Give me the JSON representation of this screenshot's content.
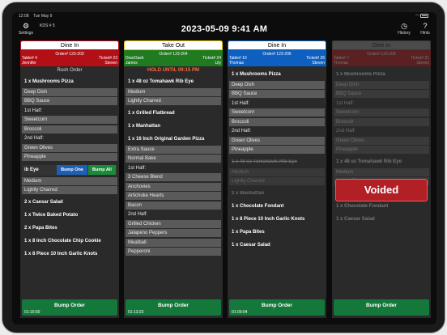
{
  "status": {
    "time": "12:08",
    "date": "Tue May 9"
  },
  "top": {
    "settings_label": "Settings",
    "kds_label": "KDS # 5",
    "clock": "2023-05-09  9:41 AM",
    "history_label": "History",
    "hints_label": "Hints"
  },
  "colors": {
    "dinein": "#b30f16",
    "takeout": "#1f7a20",
    "dinein_blue": "#0d5fc0",
    "bump": "#14783a",
    "voided": "#b21f25"
  },
  "tickets": [
    {
      "title": "Dine In",
      "order": "Order# 123-203",
      "left1": "Table# 4",
      "left2": "Jennifer",
      "right1": "Ticket# 23",
      "right2": "Steven",
      "subtitle": "Rush Order",
      "items": [
        {
          "name": "1 x Mushrooms Pizza",
          "mods": [
            "Deep Dish",
            "BBQ Sauce",
            "1st Half:",
            "Sweetcorn",
            "Broccoli",
            "2nd Half:",
            "Green Olives",
            "Pineapple"
          ]
        },
        {
          "name": "ib Eye",
          "bump_one": "Bump One",
          "bump_all": "Bump All",
          "mods": [
            "Medium",
            "Lightly Charred"
          ]
        },
        {
          "name": "2 x Caesar Salad"
        },
        {
          "name": "1 x Twice Baked Potato"
        },
        {
          "name": "2 x Papa Bites"
        },
        {
          "name": "1 x 8 Inch Chocolate Chip Cookie"
        },
        {
          "name": "1 x 8 Piece 10 Inch Garlic Knots"
        }
      ],
      "bump_label": "Bump Order",
      "timer": "01:15:50"
    },
    {
      "title": "Take Out",
      "order": "Order# 123-204",
      "left1": "DoorDash",
      "left2": "James",
      "right1": "Ticket# 24",
      "right2": "Lily",
      "subtitle": "HOLD UNTIL 09:15 PM",
      "items": [
        {
          "name": "1 x 48 oz Tomahawk Rib Eye",
          "mods": [
            "Medium",
            "Lightly Charred"
          ]
        },
        {
          "name": "1 x Grilled Flatbread"
        },
        {
          "name": "1 x Manhattan"
        },
        {
          "name": "1 x 16 Inch Original Garden Pizza",
          "mods": [
            "Extra Sauce",
            "Normal Bake",
            "1st Half:",
            "3 Cheese Blend",
            "Anchovies",
            "Artichoke Hearts",
            "Bacon",
            "2nd Half:",
            "Grilled Chicken",
            "Jalapeno Peppers",
            "Meatball",
            "Pepperoni"
          ]
        }
      ],
      "bump_label": "Bump Order",
      "timer": "01:13:23"
    },
    {
      "title": "Dine In",
      "order": "Order# 123-206",
      "left1": "Table# 10",
      "left2": "Thomas",
      "right1": "Ticket# 26",
      "right2": "Steven",
      "items": [
        {
          "name": "1 x Mushrooms Pizza",
          "mods": [
            "Deep Dish",
            "BBQ Sauce",
            "1st Half:",
            "Sweetcorn",
            "Broccoli",
            "2nd Half:",
            "Green Olives",
            "Pineapple"
          ]
        },
        {
          "name": "1 x 48 oz Tomahawk Rib Eye",
          "mods": [
            "Medium",
            "Lightly Charred"
          ]
        },
        {
          "name": "2 x Manhattan"
        },
        {
          "name": "1 x Chocolate Fondant"
        },
        {
          "name": "1 x 8 Piece 10 Inch Garlic Knots"
        },
        {
          "name": "1 x Papa Bites"
        },
        {
          "name": "1 x Caesar Salad"
        }
      ],
      "bump_label": "Bump Order",
      "timer": "01:09:04"
    },
    {
      "title": "Dine In",
      "order": "Order# 123-209",
      "left1": "Table# 7",
      "left2": "Thomas",
      "right1": "Ticket# 31",
      "right2": "Steven",
      "voided_label": "Voided",
      "items": [
        {
          "name": "1 x Mushrooms Pizza",
          "mods": [
            "Deep Dish",
            "BBQ Sauce",
            "1st Half:",
            "Sweetcorn",
            "Broccoli",
            "2nd Half:",
            "Green Olives",
            "Pineapple"
          ]
        },
        {
          "name": "1 x 48 oz Tomahawk Rib Eye",
          "mods": [
            "Medium",
            "Lightly Charred"
          ]
        },
        {
          "name": "2 x Manhattan"
        },
        {
          "name": "1 x Chocolate Fondant"
        },
        {
          "name": "1 x Caesar Salad"
        }
      ],
      "bump_label": "Bump Order"
    }
  ]
}
